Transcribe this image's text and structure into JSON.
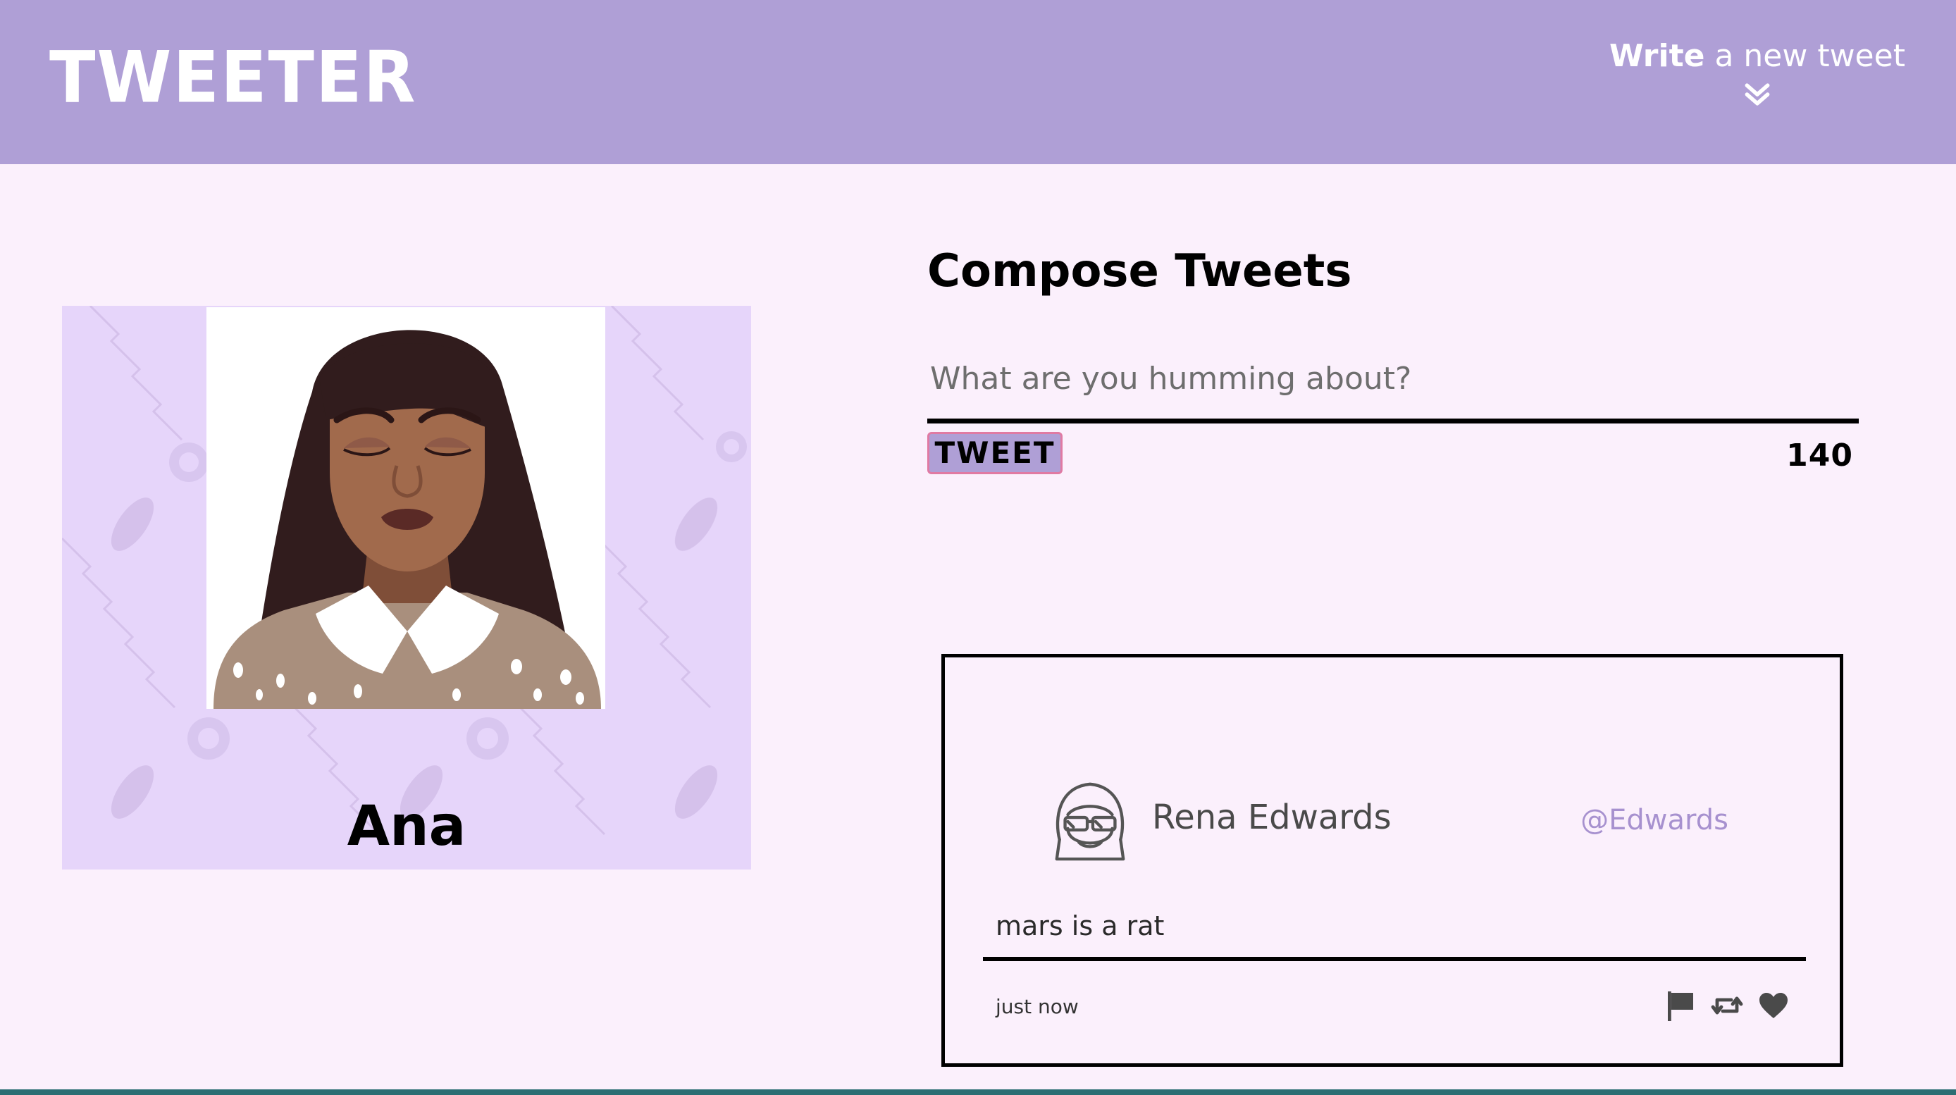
{
  "nav": {
    "brand": "TWEETER",
    "compose_bold": "Write",
    "compose_rest": " a new tweet",
    "compose_icon": "double-chevron-down-icon"
  },
  "profile": {
    "name": "Ana",
    "background_color": "#e6d5fa"
  },
  "compose": {
    "title": "Compose Tweets",
    "placeholder": "What are you humming about?",
    "button_label": "TWEET",
    "counter": "140"
  },
  "tweet": {
    "author_name": "Rena Edwards",
    "handle": "@Edwards",
    "text": "mars is a rat",
    "timestamp": "just now",
    "actions": [
      "flag-icon",
      "retweet-icon",
      "heart-icon"
    ]
  },
  "colors": {
    "header": "#af9fd6",
    "page_background": "#fbf0fc",
    "handle": "#a791cf",
    "button_border": "#e07aa3"
  }
}
